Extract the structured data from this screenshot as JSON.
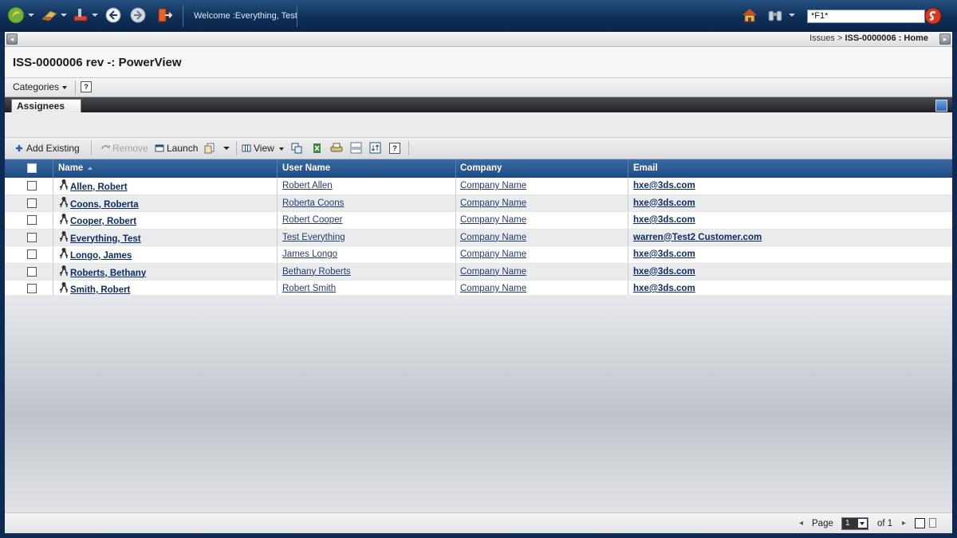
{
  "topbar": {
    "welcome": "Welcome :Everything, Test",
    "search_value": "*F1*"
  },
  "breadcrumb": {
    "parent": "Issues",
    "separator": ">",
    "current": "ISS-0000006 : Home"
  },
  "page": {
    "title": "ISS-0000006 rev -: PowerView"
  },
  "categories_label": "Categories",
  "tabs": [
    {
      "label": "Assignees",
      "active": true
    }
  ],
  "toolbar": {
    "add_existing": "Add Existing",
    "remove": "Remove",
    "launch": "Launch",
    "view": "View"
  },
  "table": {
    "columns": [
      "Name",
      "User Name",
      "Company",
      "Email"
    ],
    "rows": [
      {
        "name": "Allen, Robert",
        "username": "Robert Allen",
        "company": "Company Name",
        "email": "hxe@3ds.com"
      },
      {
        "name": "Coons, Roberta",
        "username": "Roberta Coons",
        "company": "Company Name",
        "email": "hxe@3ds.com"
      },
      {
        "name": "Cooper, Robert",
        "username": "Robert Cooper",
        "company": "Company Name",
        "email": "hxe@3ds.com"
      },
      {
        "name": "Everything, Test",
        "username": "Test Everything",
        "company": "Company Name",
        "email": "warren@Test2 Customer.com"
      },
      {
        "name": "Longo, James",
        "username": "James Longo",
        "company": "Company Name",
        "email": "hxe@3ds.com"
      },
      {
        "name": "Roberts, Bethany",
        "username": "Bethany Roberts",
        "company": "Company Name",
        "email": "hxe@3ds.com"
      },
      {
        "name": "Smith, Robert",
        "username": "Robert Smith",
        "company": "Company Name",
        "email": "hxe@3ds.com"
      }
    ]
  },
  "pagination": {
    "page_label": "Page",
    "current_page": "1",
    "of_label": "of 1"
  },
  "colors": {
    "topbar": "#0f2f59",
    "grid_header": "#1d4a82",
    "link": "#0d2c66"
  }
}
